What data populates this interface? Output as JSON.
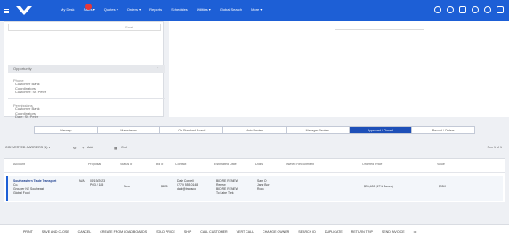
{
  "brand": {
    "accent": "#1d5fd6",
    "tab_active": "#1d4fb8",
    "badge": "#e5373a"
  },
  "nav": {
    "items": [
      "My Desk",
      "Sales",
      "Quotes",
      "Orders",
      "Reports",
      "Schedules",
      "Utilities",
      "Global Search",
      "More"
    ],
    "has_dropdown": [
      false,
      true,
      true,
      true,
      false,
      false,
      true,
      false,
      true
    ]
  },
  "right_icons": [
    "check-icon",
    "help-icon",
    "chat-icon",
    "user-icon",
    "phone-icon",
    "menu-icon"
  ],
  "filter": {
    "select_value": "Email",
    "section_label": "Opportunity",
    "blocks": [
      {
        "label": "Phone",
        "lines": [
          "Customer Bank",
          "Coordinators",
          "Customer: St. Peter"
        ]
      },
      {
        "label": "Permissions",
        "lines": [
          "Customer Bank",
          "Coordinators",
          "Date: St. Peter"
        ]
      }
    ]
  },
  "right_panel": {
    "field": ""
  },
  "tabs": [
    "Warmup",
    "Mainstream",
    "On Standard Board",
    "Main Review",
    "Manager Review",
    "Approved / Closed",
    "Record / Orders"
  ],
  "active_tab": 5,
  "toolbar": {
    "view": "CONVERTED CARRIERS (1)",
    "action_label": "Add",
    "export_label": "Grid",
    "right": "Rec 1 of 1"
  },
  "table": {
    "headers": [
      "Account",
      "Proposal",
      "Status #",
      "Bid #",
      "Contact",
      "Estimated Date",
      "Dolls",
      "Owned Recruitment",
      "Ordered Price",
      "Value"
    ],
    "rows": [
      {
        "account": [
          "Southeastern Trade Transport",
          "Co.",
          "Grouper NE Southeast",
          "Global Food"
        ],
        "flag": "N/A",
        "proposal": [
          "01/19/2023",
          "PO3 / 185"
        ],
        "status": "New",
        "bid": "$875",
        "contact": [
          "Dale Cordell",
          "(770) 555-0148",
          "dale@transco"
        ],
        "estimated": [
          "BID RE RENEW",
          "Renew",
          "BID RE RENEW",
          "To Labe Trek"
        ],
        "dolls": [
          "Sam O",
          "Jane Bor",
          "Rock"
        ],
        "owned": "",
        "ordered": "$96,400 (47% Saved)",
        "value": "$95K"
      }
    ]
  },
  "bottom_actions": [
    "PRINT",
    "SAVE AND CLOSE",
    "CANCEL",
    "CREATE FROM LOAD BOARDS",
    "SOLD PRICE",
    "SHIP",
    "CALL CUSTOMER",
    "VERT CALL",
    "CHANGE OWNER",
    "SEARCH ID",
    "DUPLICATE",
    "RETURN TRIP",
    "SEND INVOICE",
    "•••"
  ]
}
